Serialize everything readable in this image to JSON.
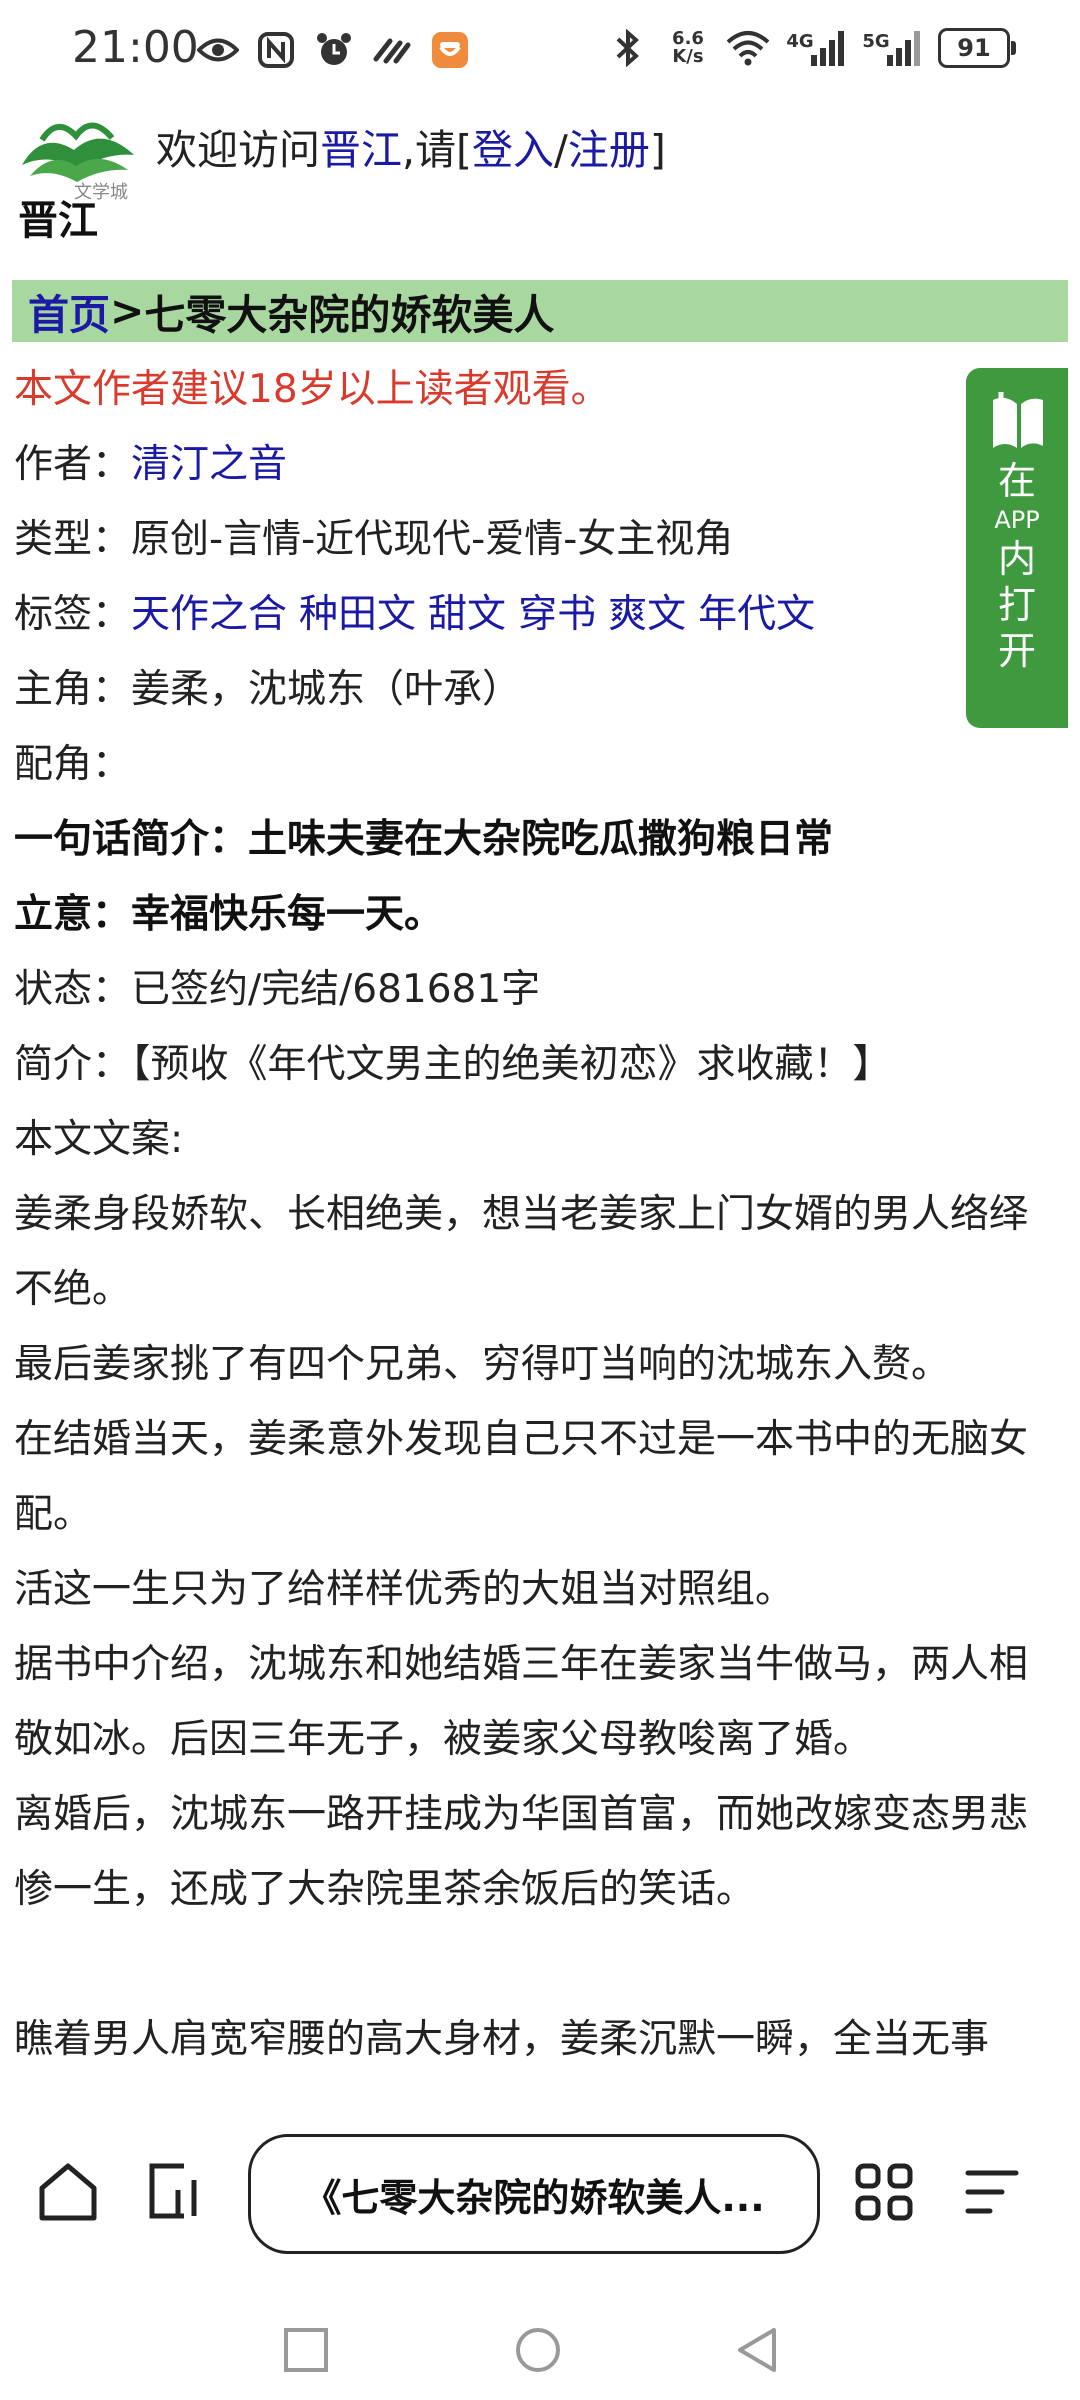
{
  "status_bar": {
    "time": "21:00",
    "net_speed_top": "6.6",
    "net_speed_bottom": "K/s",
    "net_4g": "4G",
    "net_5g": "5G",
    "battery": "91",
    "left_icons": [
      "eye-icon",
      "nfc-icon",
      "alarm-icon",
      "link-icon",
      "app-notification-icon"
    ],
    "right_icons": [
      "bluetooth-icon",
      "wifi-icon",
      "signal-4g-icon",
      "signal-5g-icon",
      "battery-icon"
    ]
  },
  "header": {
    "logo_text": "晋江 文学城",
    "welcome_prefix": "欢迎访问",
    "site_name": "晋江",
    "welcome_mid": ",请[",
    "login": "登入",
    "slash": "/",
    "register": "注册",
    "welcome_suffix": "]"
  },
  "breadcrumb": {
    "home": "首页",
    "separator": ">",
    "current": "七零大杂院的娇软美人"
  },
  "content": {
    "warning": "本文作者建议18岁以上读者观看。",
    "author_label": "作者：",
    "author": "清汀之音",
    "type_label": "类型：",
    "type": "原创-言情-近代现代-爱情-女主视角",
    "tags_label": "标签：",
    "tags": [
      "天作之合",
      "种田文",
      "甜文",
      "穿书",
      "爽文",
      "年代文"
    ],
    "protagonist_label": "主角：",
    "protagonist": "姜柔，沈城东（叶承）",
    "supporting_label": "配角：",
    "supporting": "",
    "one_line_label": "一句话简介：",
    "one_line": "土味夫妻在大杂院吃瓜撒狗粮日常",
    "theme_label": "立意：",
    "theme": "幸福快乐每一天。",
    "status_label": "状态：",
    "status": "已签约/完结/681681字",
    "intro_label": "简介：",
    "intro": "【预收《年代文男主的绝美初恋》求收藏！】",
    "copy_label": "本文文案:",
    "paragraphs": [
      "姜柔身段娇软、长相绝美，想当老姜家上门女婿的男人络绎不绝。",
      "最后姜家挑了有四个兄弟、穷得叮当响的沈城东入赘。",
      "在结婚当天，姜柔意外发现自己只不过是一本书中的无脑女配。",
      "活这一生只为了给样样优秀的大姐当对照组。",
      "据书中介绍，沈城东和她结婚三年在姜家当牛做马，两人相敬如冰。后因三年无子，被姜家父母教唆离了婚。",
      "离婚后，沈城东一路开挂成为华国首富，而她改嫁变态男悲惨一生，还成了大杂院里茶余饭后的笑话。"
    ],
    "last_line": "瞧着男人肩宽窄腰的高大身材，姜柔沉默一瞬，全当无事"
  },
  "app_button": {
    "line1": "在",
    "line2": "APP",
    "line3": "内",
    "line4": "打",
    "line5": "开"
  },
  "toolbar": {
    "url_title": "《七零大杂院的娇软美人..."
  },
  "colors": {
    "breadcrumb_bg": "#a8d8a0",
    "link_blue": "#1a1aa6",
    "warning_red": "#d93a2b",
    "app_green": "#3f9a3f"
  }
}
